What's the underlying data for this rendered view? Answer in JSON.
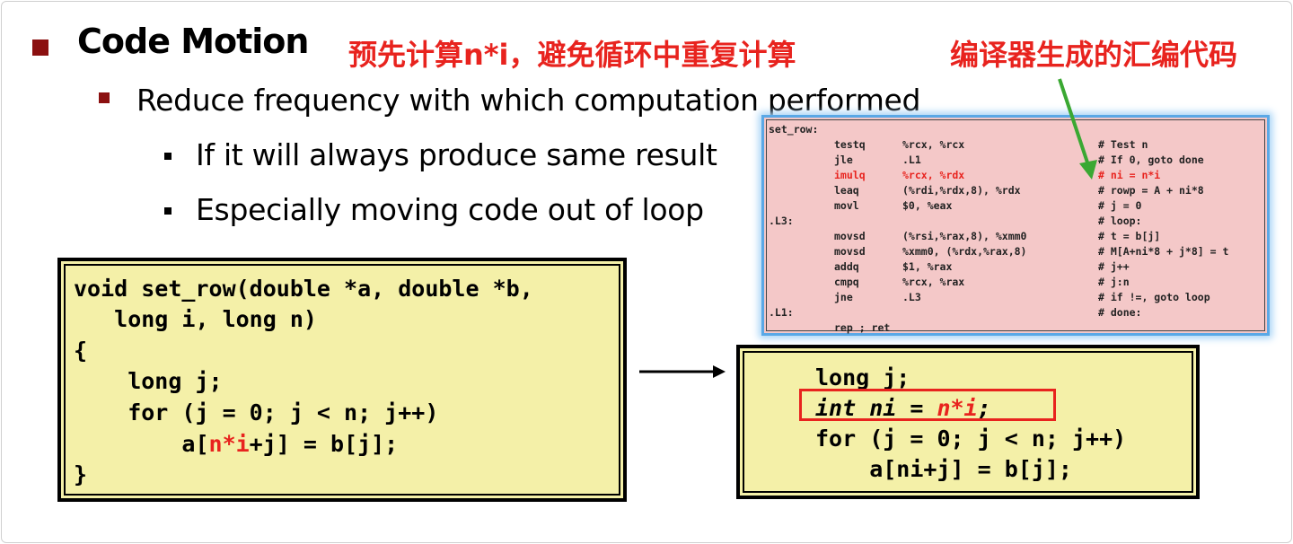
{
  "slide": {
    "title": "Code Motion",
    "annotation_left": "预先计算n*i，避免循环中重复计算",
    "annotation_right": "编译器生成的汇编代码",
    "bullet_l2": "Reduce frequency with which computation performed",
    "bullets_l3": [
      "If it will always produce same result",
      "Especially moving code out of loop"
    ]
  },
  "colors": {
    "accent_red": "#e8231e",
    "bullet_red": "#8b1010",
    "code_bg": "#f4f0a8",
    "asm_bg": "#f4c8c8",
    "arrow_green": "#3aa832"
  },
  "icons": {
    "green_arrow": "arrow-down-left-icon",
    "black_arrow": "arrow-right-icon"
  },
  "original_code": {
    "l1": "void set_row(double *a, double *b,",
    "l2": "   long i, long n)",
    "l3": "{",
    "l4": "    long j;",
    "l5": "    for (j = 0; j < n; j++)",
    "l6_pre": "        a[",
    "l6_hl": "n*i",
    "l6_post": "+j] = b[j];",
    "l7": "}"
  },
  "optimized_code": {
    "l1": "long j;",
    "l2_a": "int ni = ",
    "l2_hl": "n*i",
    "l2_b": ";",
    "l3": "for (j = 0; j < n; j++)",
    "l4": "    a[ni+j] = b[j];"
  },
  "asm": {
    "label_set_row": "set_row:",
    "label_l3": ".L3:",
    "label_l1": ".L1:",
    "rows": [
      {
        "op": "testq",
        "args": "%rcx, %rcx",
        "comment": "# Test n"
      },
      {
        "op": "jle",
        "args": ".L1",
        "comment": "# If 0, goto done"
      },
      {
        "op": "imulq",
        "args": "%rcx, %rdx",
        "comment": "# ni = n*i"
      },
      {
        "op": "leaq",
        "args": "(%rdi,%rdx,8), %rdx",
        "comment": "# rowp = A + ni*8"
      },
      {
        "op": "movl",
        "args": "$0, %eax",
        "comment": "# j = 0"
      },
      {
        "op": "",
        "args": "",
        "comment": "# loop:"
      },
      {
        "op": "movsd",
        "args": "(%rsi,%rax,8), %xmm0",
        "comment": "# t = b[j]"
      },
      {
        "op": "movsd",
        "args": "%xmm0, (%rdx,%rax,8)",
        "comment": "# M[A+ni*8 + j*8] = t"
      },
      {
        "op": "addq",
        "args": "$1, %rax",
        "comment": "# j++"
      },
      {
        "op": "cmpq",
        "args": "%rcx, %rax",
        "comment": "# j:n"
      },
      {
        "op": "jne",
        "args": ".L3",
        "comment": "# if !=, goto loop"
      },
      {
        "op": "",
        "args": "",
        "comment": "# done:"
      },
      {
        "op": "rep ; ret",
        "args": "",
        "comment": ""
      }
    ]
  }
}
